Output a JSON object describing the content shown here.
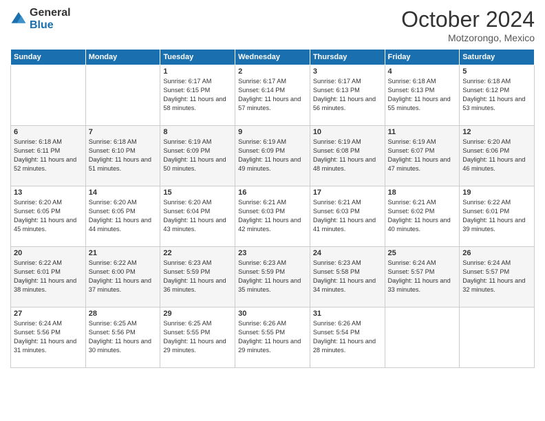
{
  "logo": {
    "general": "General",
    "blue": "Blue"
  },
  "header": {
    "month": "October 2024",
    "location": "Motzorongo, Mexico"
  },
  "weekdays": [
    "Sunday",
    "Monday",
    "Tuesday",
    "Wednesday",
    "Thursday",
    "Friday",
    "Saturday"
  ],
  "weeks": [
    [
      {
        "day": "",
        "info": ""
      },
      {
        "day": "",
        "info": ""
      },
      {
        "day": "1",
        "info": "Sunrise: 6:17 AM\nSunset: 6:15 PM\nDaylight: 11 hours and 58 minutes."
      },
      {
        "day": "2",
        "info": "Sunrise: 6:17 AM\nSunset: 6:14 PM\nDaylight: 11 hours and 57 minutes."
      },
      {
        "day": "3",
        "info": "Sunrise: 6:17 AM\nSunset: 6:13 PM\nDaylight: 11 hours and 56 minutes."
      },
      {
        "day": "4",
        "info": "Sunrise: 6:18 AM\nSunset: 6:13 PM\nDaylight: 11 hours and 55 minutes."
      },
      {
        "day": "5",
        "info": "Sunrise: 6:18 AM\nSunset: 6:12 PM\nDaylight: 11 hours and 53 minutes."
      }
    ],
    [
      {
        "day": "6",
        "info": "Sunrise: 6:18 AM\nSunset: 6:11 PM\nDaylight: 11 hours and 52 minutes."
      },
      {
        "day": "7",
        "info": "Sunrise: 6:18 AM\nSunset: 6:10 PM\nDaylight: 11 hours and 51 minutes."
      },
      {
        "day": "8",
        "info": "Sunrise: 6:19 AM\nSunset: 6:09 PM\nDaylight: 11 hours and 50 minutes."
      },
      {
        "day": "9",
        "info": "Sunrise: 6:19 AM\nSunset: 6:09 PM\nDaylight: 11 hours and 49 minutes."
      },
      {
        "day": "10",
        "info": "Sunrise: 6:19 AM\nSunset: 6:08 PM\nDaylight: 11 hours and 48 minutes."
      },
      {
        "day": "11",
        "info": "Sunrise: 6:19 AM\nSunset: 6:07 PM\nDaylight: 11 hours and 47 minutes."
      },
      {
        "day": "12",
        "info": "Sunrise: 6:20 AM\nSunset: 6:06 PM\nDaylight: 11 hours and 46 minutes."
      }
    ],
    [
      {
        "day": "13",
        "info": "Sunrise: 6:20 AM\nSunset: 6:05 PM\nDaylight: 11 hours and 45 minutes."
      },
      {
        "day": "14",
        "info": "Sunrise: 6:20 AM\nSunset: 6:05 PM\nDaylight: 11 hours and 44 minutes."
      },
      {
        "day": "15",
        "info": "Sunrise: 6:20 AM\nSunset: 6:04 PM\nDaylight: 11 hours and 43 minutes."
      },
      {
        "day": "16",
        "info": "Sunrise: 6:21 AM\nSunset: 6:03 PM\nDaylight: 11 hours and 42 minutes."
      },
      {
        "day": "17",
        "info": "Sunrise: 6:21 AM\nSunset: 6:03 PM\nDaylight: 11 hours and 41 minutes."
      },
      {
        "day": "18",
        "info": "Sunrise: 6:21 AM\nSunset: 6:02 PM\nDaylight: 11 hours and 40 minutes."
      },
      {
        "day": "19",
        "info": "Sunrise: 6:22 AM\nSunset: 6:01 PM\nDaylight: 11 hours and 39 minutes."
      }
    ],
    [
      {
        "day": "20",
        "info": "Sunrise: 6:22 AM\nSunset: 6:01 PM\nDaylight: 11 hours and 38 minutes."
      },
      {
        "day": "21",
        "info": "Sunrise: 6:22 AM\nSunset: 6:00 PM\nDaylight: 11 hours and 37 minutes."
      },
      {
        "day": "22",
        "info": "Sunrise: 6:23 AM\nSunset: 5:59 PM\nDaylight: 11 hours and 36 minutes."
      },
      {
        "day": "23",
        "info": "Sunrise: 6:23 AM\nSunset: 5:59 PM\nDaylight: 11 hours and 35 minutes."
      },
      {
        "day": "24",
        "info": "Sunrise: 6:23 AM\nSunset: 5:58 PM\nDaylight: 11 hours and 34 minutes."
      },
      {
        "day": "25",
        "info": "Sunrise: 6:24 AM\nSunset: 5:57 PM\nDaylight: 11 hours and 33 minutes."
      },
      {
        "day": "26",
        "info": "Sunrise: 6:24 AM\nSunset: 5:57 PM\nDaylight: 11 hours and 32 minutes."
      }
    ],
    [
      {
        "day": "27",
        "info": "Sunrise: 6:24 AM\nSunset: 5:56 PM\nDaylight: 11 hours and 31 minutes."
      },
      {
        "day": "28",
        "info": "Sunrise: 6:25 AM\nSunset: 5:56 PM\nDaylight: 11 hours and 30 minutes."
      },
      {
        "day": "29",
        "info": "Sunrise: 6:25 AM\nSunset: 5:55 PM\nDaylight: 11 hours and 29 minutes."
      },
      {
        "day": "30",
        "info": "Sunrise: 6:26 AM\nSunset: 5:55 PM\nDaylight: 11 hours and 29 minutes."
      },
      {
        "day": "31",
        "info": "Sunrise: 6:26 AM\nSunset: 5:54 PM\nDaylight: 11 hours and 28 minutes."
      },
      {
        "day": "",
        "info": ""
      },
      {
        "day": "",
        "info": ""
      }
    ]
  ]
}
